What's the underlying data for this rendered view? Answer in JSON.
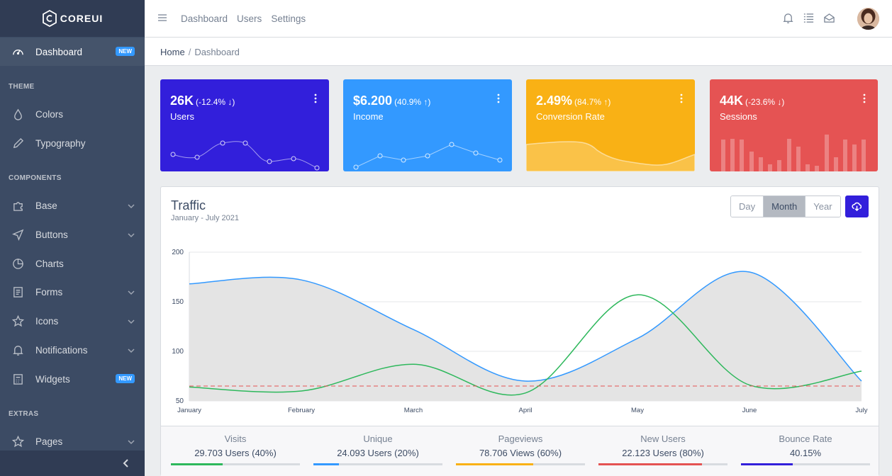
{
  "brand": {
    "name": "COREUI"
  },
  "sidebar": {
    "items": [
      {
        "label": "Dashboard",
        "icon": "speedometer-icon",
        "badge": "NEW"
      },
      {
        "section": "THEME"
      },
      {
        "label": "Colors",
        "icon": "drop-icon"
      },
      {
        "label": "Typography",
        "icon": "pencil-icon"
      },
      {
        "section": "COMPONENTS"
      },
      {
        "label": "Base",
        "icon": "puzzle-icon"
      },
      {
        "label": "Buttons",
        "icon": "cursor-icon"
      },
      {
        "label": "Charts",
        "icon": "chart-pie-icon"
      },
      {
        "label": "Forms",
        "icon": "notes-icon"
      },
      {
        "label": "Icons",
        "icon": "star-icon"
      },
      {
        "label": "Notifications",
        "icon": "bell-icon"
      },
      {
        "label": "Widgets",
        "icon": "calculator-icon",
        "badge": "NEW"
      },
      {
        "section": "EXTRAS"
      },
      {
        "label": "Pages",
        "icon": "star-icon"
      }
    ]
  },
  "header": {
    "nav": [
      "Dashboard",
      "Users",
      "Settings"
    ]
  },
  "breadcrumb": {
    "home": "Home",
    "current": "Dashboard"
  },
  "widgets": [
    {
      "value": "26K",
      "change": "(-12.4% ↓)",
      "label": "Users",
      "color": "#321fdb"
    },
    {
      "value": "$6.200",
      "change": "(40.9% ↑)",
      "label": "Income",
      "color": "#39f"
    },
    {
      "value": "2.49%",
      "change": "(84.7% ↑)",
      "label": "Conversion Rate",
      "color": "#f9b115"
    },
    {
      "value": "44K",
      "change": "(-23.6% ↓)",
      "label": "Sessions",
      "color": "#e55353"
    }
  ],
  "traffic": {
    "title": "Traffic",
    "subtitle": "January - July 2021",
    "buttons": [
      "Day",
      "Month",
      "Year"
    ],
    "active_button": "Month"
  },
  "chart_data": {
    "type": "line",
    "title": "Traffic",
    "categories": [
      "January",
      "February",
      "March",
      "April",
      "May",
      "June",
      "July"
    ],
    "ylim": [
      50,
      200
    ],
    "yticks": [
      50,
      100,
      150,
      200
    ],
    "series": [
      {
        "values": [
          168,
          172,
          122,
          70,
          113,
          180,
          70
        ],
        "color": "#39f",
        "fill": true
      },
      {
        "values": [
          64,
          60,
          87,
          58,
          157,
          66,
          80
        ],
        "color": "#2eb85c"
      },
      {
        "values": [
          65,
          65,
          65,
          65,
          65,
          65,
          65
        ],
        "color": "#e55353",
        "dashed": true
      }
    ],
    "grid": true
  },
  "stats": [
    {
      "label": "Visits",
      "value": "29.703 Users (40%)",
      "percent": 40,
      "color": "#2eb85c"
    },
    {
      "label": "Unique",
      "value": "24.093 Users (20%)",
      "percent": 20,
      "color": "#39f"
    },
    {
      "label": "Pageviews",
      "value": "78.706 Views (60%)",
      "percent": 60,
      "color": "#f9b115"
    },
    {
      "label": "New Users",
      "value": "22.123 Users (80%)",
      "percent": 80,
      "color": "#e55353"
    },
    {
      "label": "Bounce Rate",
      "value": "40.15%",
      "percent": 40,
      "color": "#321fdb"
    }
  ]
}
